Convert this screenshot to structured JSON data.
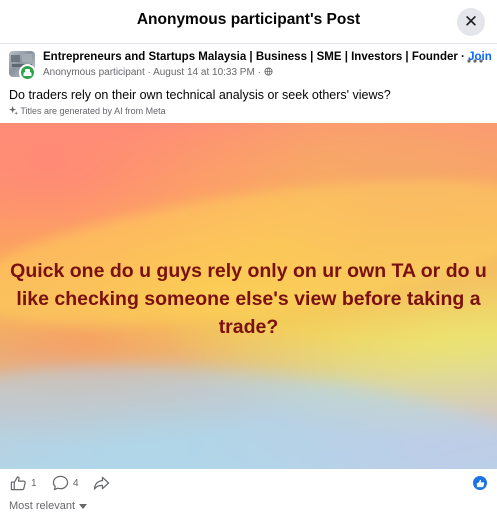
{
  "header": {
    "title": "Anonymous participant's Post",
    "close_icon": "close-icon",
    "close_glyph": "✕"
  },
  "post": {
    "group_name": "Entrepreneurs and Startups Malaysia | Business | SME | Investors | Founder",
    "separator": " · ",
    "join_label": "Join",
    "author": "Anonymous participant",
    "date": "August 14 at 10:33 PM",
    "privacy_icon": "globe-icon",
    "more_icon": "more-options-icon",
    "title": "Do traders rely on their own technical analysis or seek others' views?",
    "ai_note": "Titles are generated by AI from Meta",
    "body_text": "Quick one do u guys rely only on ur own TA or do u like checking someone else's view before taking a trade?"
  },
  "actions": {
    "like_count": "1",
    "comment_count": "4",
    "like_icon": "thumbs-up-icon",
    "comment_icon": "comment-icon",
    "share_icon": "share-icon",
    "reaction_icon": "like-reaction-icon"
  },
  "comments": {
    "sort_label": "Most relevant"
  },
  "colors": {
    "accent": "#0866ff",
    "text_primary": "#050505",
    "text_secondary": "#65676b",
    "hero_text": "#7a1010",
    "badge_green": "#31a24c"
  }
}
